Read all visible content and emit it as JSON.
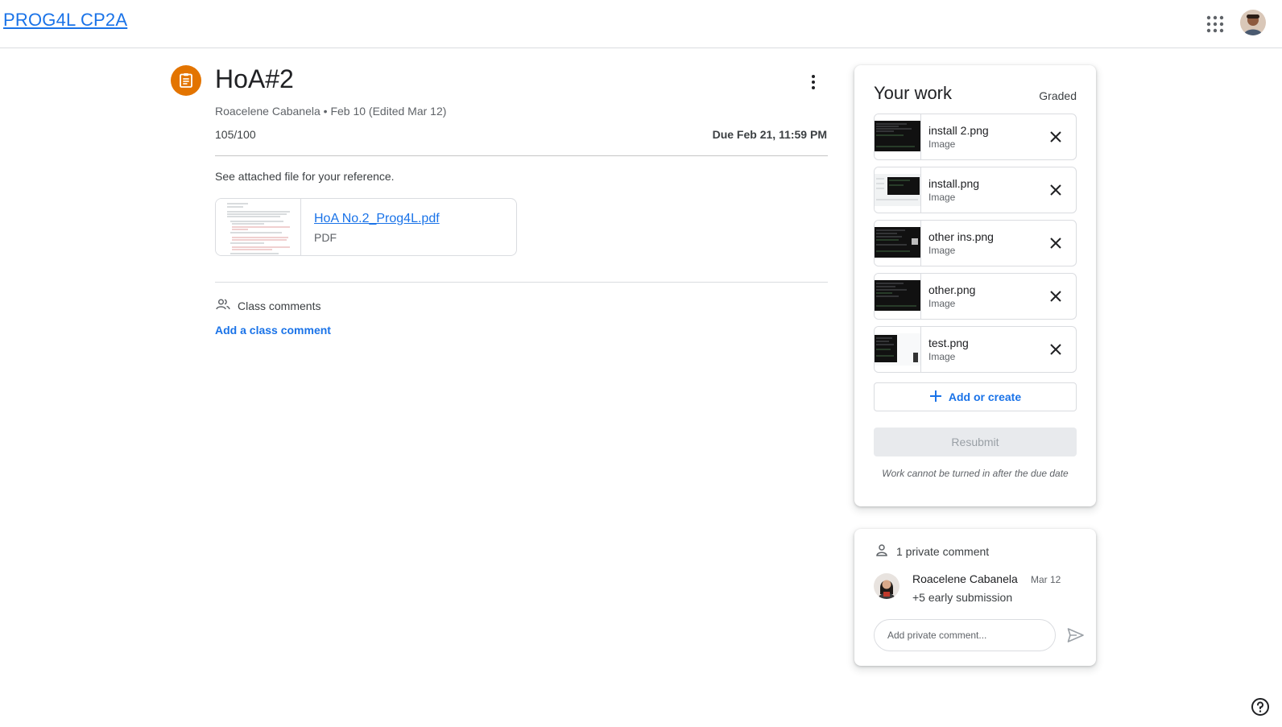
{
  "header": {
    "course_title": "PROG4L CP2A",
    "apps_icon": "apps-grid-icon",
    "account_icon": "account-avatar"
  },
  "assignment": {
    "icon": "assignment-icon",
    "title": "HoA#2",
    "meta": "Roacelene Cabanela • Feb 10 (Edited Mar 12)",
    "points": "105/100",
    "due": "Due Feb 21, 11:59 PM",
    "description": "See attached file for your reference.",
    "attachment": {
      "name": "HoA No.2_Prog4L.pdf",
      "type": "PDF"
    }
  },
  "class_comments": {
    "heading": "Class comments",
    "add_link": "Add a class comment"
  },
  "your_work": {
    "title": "Your work",
    "status": "Graded",
    "files": [
      {
        "name": "install 2.png",
        "type": "Image"
      },
      {
        "name": "install.png",
        "type": "Image"
      },
      {
        "name": "other ins.png",
        "type": "Image"
      },
      {
        "name": "other.png",
        "type": "Image"
      },
      {
        "name": "test.png",
        "type": "Image"
      }
    ],
    "add_create": "Add or create",
    "resubmit": "Resubmit",
    "note": "Work cannot be turned in after the due date"
  },
  "private_comments": {
    "heading": "1 private comment",
    "comment": {
      "author": "Roacelene Cabanela",
      "date": "Mar 12",
      "text": "+5 early submission"
    },
    "input_placeholder": "Add private comment..."
  },
  "colors": {
    "link_blue": "#1a73e8",
    "assignment_orange": "#e37400",
    "border": "#dadce0"
  }
}
